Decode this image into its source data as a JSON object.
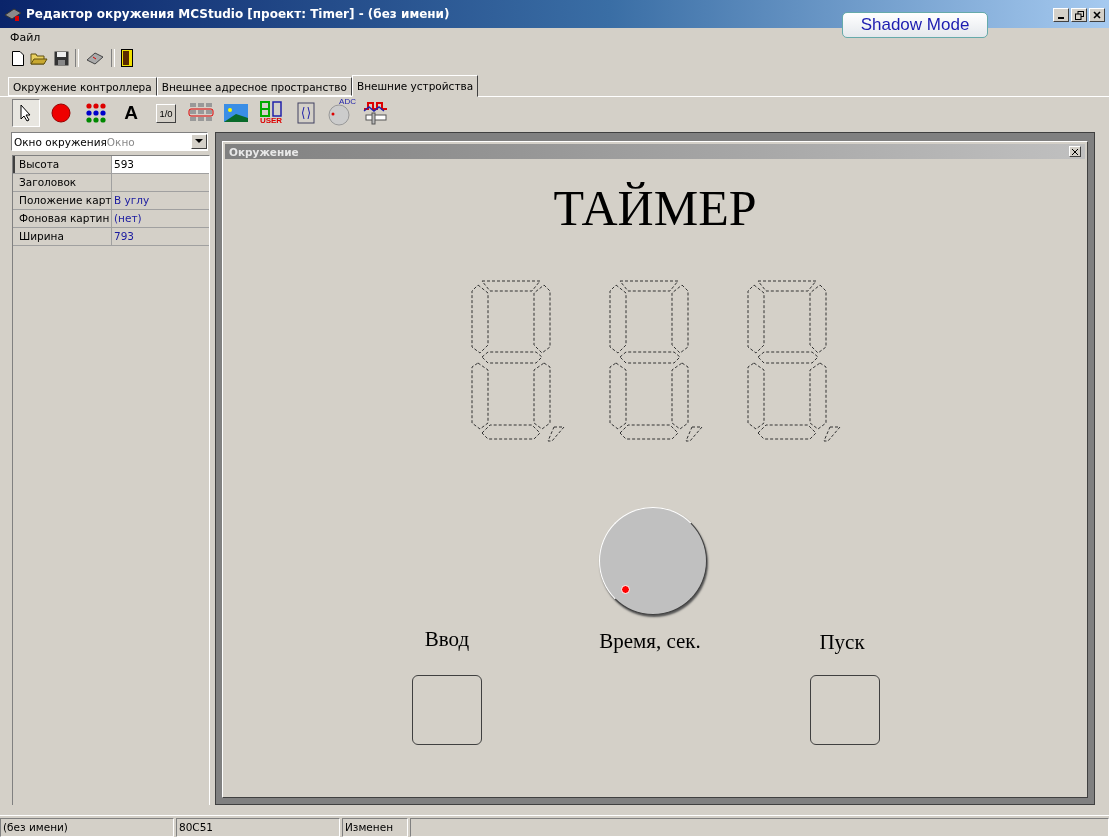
{
  "window": {
    "title": "Редактор окружения MCStudio [проект: Timer] - (без имени)"
  },
  "shadow_button": "Shadow Mode",
  "menu": [
    "Файл"
  ],
  "tabs": [
    {
      "label": "Окружение контроллера",
      "selected": false
    },
    {
      "label": "Внешнее адресное пространство",
      "selected": false
    },
    {
      "label": "Внешние устройства",
      "selected": true
    }
  ],
  "palette": [
    {
      "kind": "pointer",
      "selected": true
    },
    {
      "kind": "led",
      "selected": false
    },
    {
      "kind": "matrix",
      "selected": false
    },
    {
      "kind": "text",
      "label": "A",
      "selected": false
    },
    {
      "kind": "switch",
      "label": "1/0",
      "selected": false
    },
    {
      "kind": "keypad",
      "selected": false
    },
    {
      "kind": "image",
      "selected": false
    },
    {
      "kind": "indicator",
      "label": "USER",
      "selected": false
    },
    {
      "kind": "encoder",
      "selected": false
    },
    {
      "kind": "adc",
      "label": "ADC",
      "selected": false
    },
    {
      "kind": "signal",
      "selected": false
    }
  ],
  "object_combo": {
    "value": "Окно окружения",
    "hint": "Окно"
  },
  "properties": [
    {
      "name": "Высота",
      "value": "593",
      "selected": true
    },
    {
      "name": "Заголовок",
      "selected": false
    },
    {
      "name": "Положение карт",
      "value": "В углу",
      "selected": false
    },
    {
      "name": "Фоновая картин",
      "value": "(нет)",
      "selected": false
    },
    {
      "name": "Ширина",
      "value": "793",
      "selected": false
    }
  ],
  "environment": {
    "title": "Окружение",
    "heading": "ТАЙМЕР",
    "digits": [
      {
        "kind": "seven-segment"
      },
      {
        "kind": "seven-segment"
      },
      {
        "kind": "seven-segment"
      }
    ],
    "knob": {
      "label": "Время, сек."
    },
    "buttons": [
      {
        "label": "Ввод"
      },
      {
        "label": "Пуск"
      }
    ]
  },
  "status_bar": [
    "(без имени)",
    "80C51",
    "Изменен"
  ]
}
